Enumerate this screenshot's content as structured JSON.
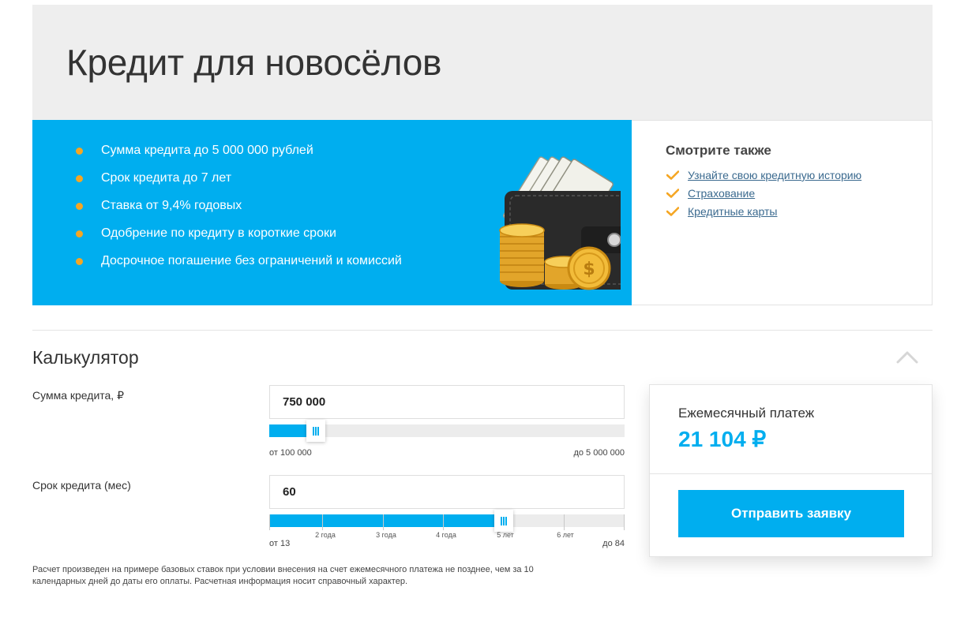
{
  "hero": {
    "title": "Кредит для новосёлов"
  },
  "features": {
    "items": [
      "Сумма кредита до 5 000 000 рублей",
      "Срок кредита до 7 лет",
      "Ставка от 9,4% годовых",
      "Одобрение по кредиту в короткие сроки",
      "Досрочное погашение без ограничений и комиссий"
    ]
  },
  "see_also": {
    "title": "Смотрите также",
    "links": [
      "Узнайте свою кредитную историю",
      "Страхование",
      "Кредитные карты"
    ]
  },
  "calculator": {
    "title": "Калькулятор",
    "amount": {
      "label": "Сумма кредита, ₽",
      "value": "750 000",
      "min_label": "от 100 000",
      "max_label": "до 5 000 000",
      "fill_fraction": 0.13
    },
    "term": {
      "label": "Срок кредита (мес)",
      "value": "60",
      "min_label": "от 13",
      "max_label": "до 84",
      "tick_labels": [
        "2 года",
        "3 года",
        "4 года",
        "5 лет",
        "6 лет"
      ],
      "fill_fraction": 0.66
    },
    "disclaimer": "Расчет произведен на примере базовых ставок при условии внесения на счет ежемесячного платежа не позднее, чем за 10 календарных дней до даты его оплаты. Расчетная информация носит справочный характер."
  },
  "result": {
    "label": "Ежемесячный платеж",
    "value": "21 104 ₽",
    "submit_label": "Отправить заявку"
  },
  "colors": {
    "accent": "#00aeef",
    "bullet": "#f5a623",
    "hero_bg": "#eeeeee",
    "link": "#3b6a8f"
  },
  "icons": {
    "bullet": "dot",
    "see_also": "check-icon",
    "collapse": "chevron-up-icon",
    "promo": "wallet-money-icon"
  }
}
